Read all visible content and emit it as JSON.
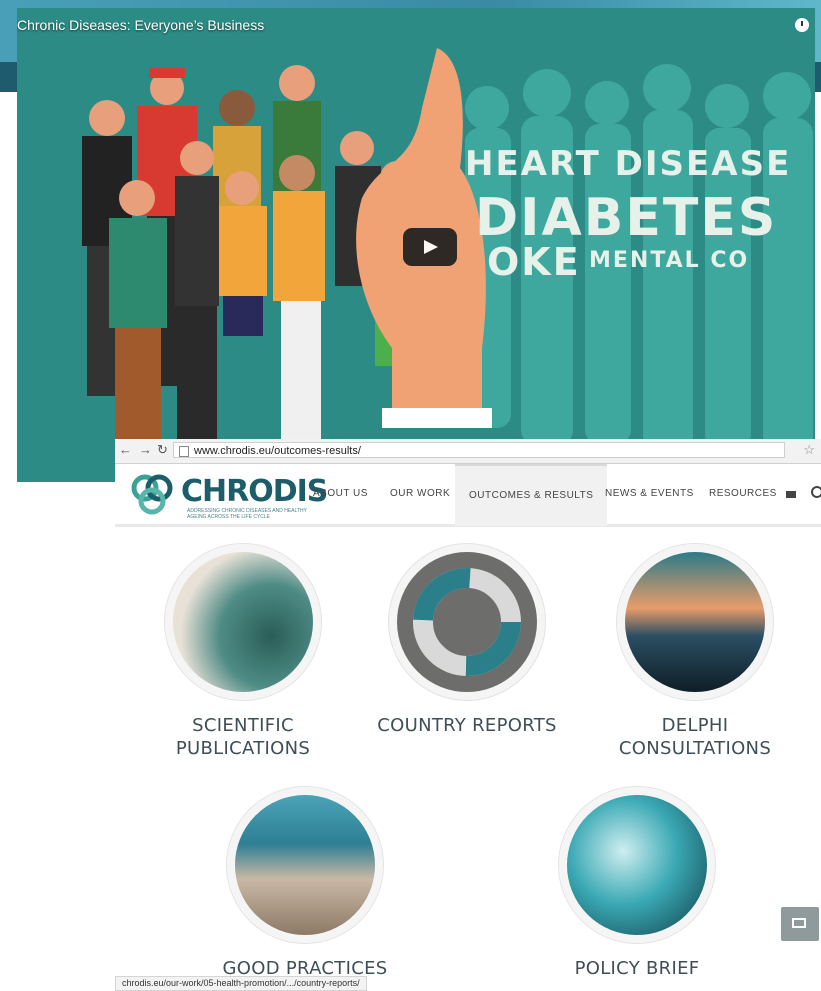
{
  "video": {
    "title": "Chronic Diseases: Everyone’s Business",
    "overlay_words": [
      "HEART DISEASE",
      "DIABETES",
      "OKE",
      "MENTAL CO"
    ],
    "play_icon": "play-icon",
    "clock_icon": "watch-later-icon"
  },
  "browser": {
    "url": "www.chrodis.eu/outcomes-results/",
    "status_url": "chrodis.eu/our-work/05-health-promotion/.../country-reports/"
  },
  "site": {
    "logo_text": "CHRODIS",
    "logo_subtitle": "ADDRESSING CHRONIC DISEASES AND HEALTHY AGEING ACROSS THE LIFE CYCLE",
    "menu": [
      "ABOUT US",
      "OUR WORK",
      "OUTCOMES & RESULTS",
      "NEWS & EVENTS",
      "RESOURCES"
    ],
    "active_menu": "OUTCOMES & RESULTS"
  },
  "tiles": [
    {
      "label_1": "SCIENTIFIC",
      "label_2": "PUBLICATIONS"
    },
    {
      "label_1": "COUNTRY REPORTS",
      "label_2": ""
    },
    {
      "label_1": "DELPHI",
      "label_2": "CONSULTATIONS"
    },
    {
      "label_1": "GOOD PRACTICES",
      "label_2": ""
    },
    {
      "label_1": "POLICY BRIEF",
      "label_2": ""
    }
  ],
  "colors": {
    "brand": "#1d5d69",
    "video_bg": "#2c8c85",
    "text": "#3f4f58"
  }
}
